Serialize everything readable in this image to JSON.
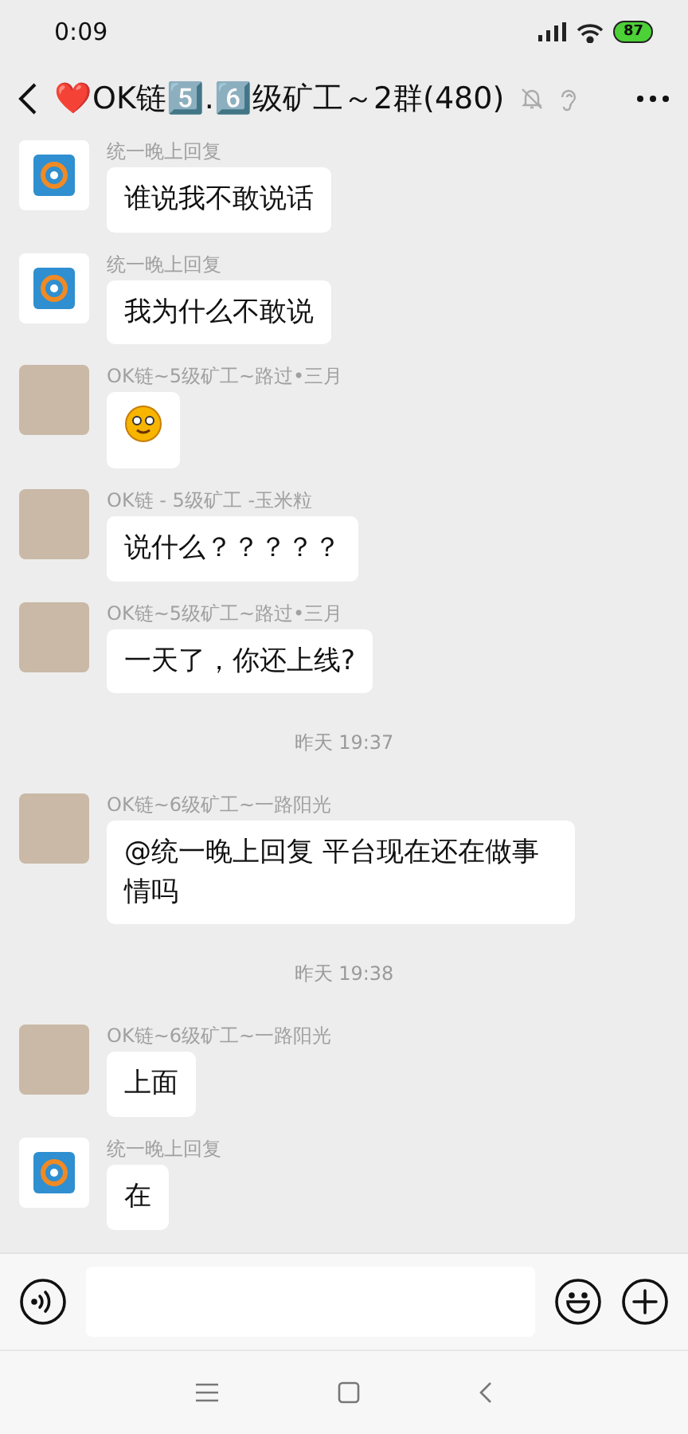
{
  "status_bar": {
    "time": "0:09",
    "battery": "87"
  },
  "header": {
    "title": "❤️OK链5️⃣.6️⃣级矿工～2群(480)",
    "muted": true
  },
  "messages": [
    {
      "kind": "text",
      "sender": "统一晚上回复",
      "logo_avatar": true,
      "text": "谁说我不敢说话"
    },
    {
      "kind": "text",
      "sender": "统一晚上回复",
      "logo_avatar": true,
      "text": "我为什么不敢说"
    },
    {
      "kind": "emoji",
      "sender": "OK链~5级矿工~路过•三月",
      "logo_avatar": false
    },
    {
      "kind": "text",
      "sender": "OK链 - 5级矿工 -玉米粒",
      "logo_avatar": false,
      "text": "说什么？？？？？"
    },
    {
      "kind": "text",
      "sender": "OK链~5级矿工~路过•三月",
      "logo_avatar": false,
      "text": "一天了，你还上线?"
    },
    {
      "kind": "time",
      "text": "昨天 19:37"
    },
    {
      "kind": "text",
      "sender": "OK链~6级矿工~一路阳光",
      "logo_avatar": false,
      "text": "@统一晚上回复  平台现在还在做事情吗"
    },
    {
      "kind": "time",
      "text": "昨天 19:38"
    },
    {
      "kind": "text",
      "sender": "OK链~6级矿工~一路阳光",
      "logo_avatar": false,
      "text": "上面"
    },
    {
      "kind": "text",
      "sender": "统一晚上回复",
      "logo_avatar": true,
      "text": "在"
    }
  ]
}
